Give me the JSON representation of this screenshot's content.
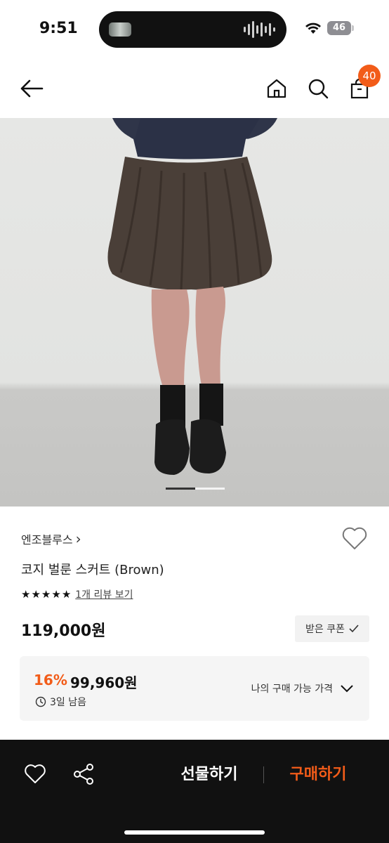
{
  "status_bar": {
    "time": "9:51",
    "battery": "46"
  },
  "header": {
    "cart_count": "40"
  },
  "gallery": {
    "current_slide_fraction": 0.5
  },
  "product": {
    "brand": "엔조블루스",
    "brand_chevron": "›",
    "title": "코지 벌룬 스커트 (Brown)",
    "rating_stars": 5,
    "review_link": "1개 리뷰 보기",
    "price": "119,000원",
    "coupon_button": "받은 쿠폰"
  },
  "discount": {
    "rate": "16%",
    "price": "99,960원",
    "timer": "3일 남음",
    "my_price_label": "나의 구매 가능 가격"
  },
  "bottom_bar": {
    "gift": "선물하기",
    "buy": "구매하기"
  },
  "colors": {
    "accent": "#f25c19",
    "bottom_bar_bg": "#111111"
  },
  "icons": {
    "back": "arrow-left-icon",
    "home": "home-icon",
    "search": "search-icon",
    "cart": "shopping-bag-icon",
    "like": "heart-icon",
    "share": "share-icon",
    "clock": "clock-icon",
    "chevron": "chevron-down-icon",
    "check": "check-icon",
    "star": "star-icon"
  }
}
